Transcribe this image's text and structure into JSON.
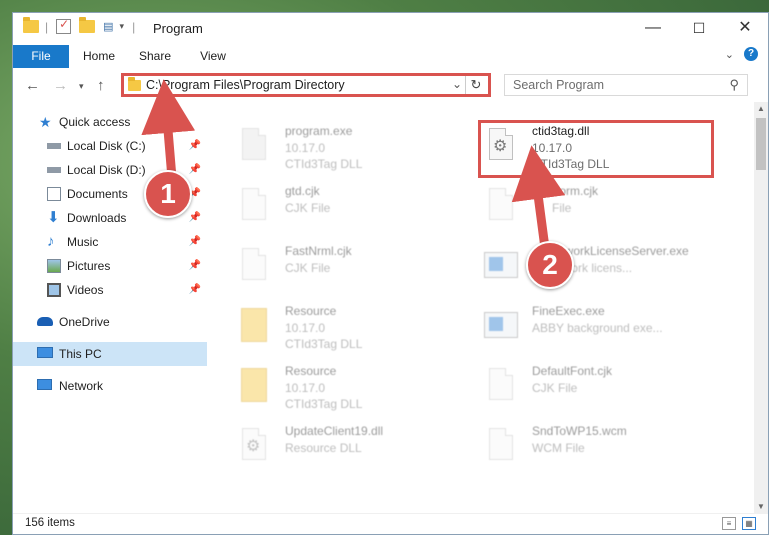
{
  "window": {
    "title": "Program",
    "controls": {
      "minimize": "—",
      "maximize": "☐",
      "close": "✕"
    }
  },
  "ribbon": {
    "tabs": [
      "File",
      "Home",
      "Share",
      "View"
    ],
    "expand_icon": "chevron-down-icon",
    "help": "?"
  },
  "address": {
    "path": "C:\\Program Files\\Program Directory",
    "search_placeholder": "Search Program"
  },
  "sidebar": {
    "items": [
      {
        "label": "Quick access",
        "icon": "star-icon",
        "pinned": false
      },
      {
        "label": "Local Disk (C:)",
        "icon": "drive-icon",
        "pinned": true
      },
      {
        "label": "Local Disk (D:)",
        "icon": "drive-icon",
        "pinned": true
      },
      {
        "label": "Documents",
        "icon": "documents-icon",
        "pinned": true
      },
      {
        "label": "Downloads",
        "icon": "download-icon",
        "pinned": true
      },
      {
        "label": "Music",
        "icon": "music-icon",
        "pinned": true
      },
      {
        "label": "Pictures",
        "icon": "pictures-icon",
        "pinned": true
      },
      {
        "label": "Videos",
        "icon": "videos-icon",
        "pinned": true
      },
      {
        "label": "OneDrive",
        "icon": "cloud-icon",
        "pinned": false
      },
      {
        "label": "This PC",
        "icon": "computer-icon",
        "pinned": false,
        "selected": true
      },
      {
        "label": "Network",
        "icon": "network-icon",
        "pinned": false
      }
    ]
  },
  "files": [
    {
      "name": "program.exe",
      "meta1": "10.17.0",
      "meta2": "CTId3Tag DLL",
      "icon": "exe-icon",
      "faded": true
    },
    {
      "name": "ctid3tag.dll",
      "meta1": "10.17.0",
      "meta2": "CTId3Tag DLL",
      "icon": "dll-gear-icon",
      "faded": false,
      "highlighted": true
    },
    {
      "name": "gtd.cjk",
      "meta1": "CJK File",
      "meta2": "",
      "icon": "file-icon",
      "faded": true
    },
    {
      "name": "Form.cjk",
      "meta1": "File",
      "meta2": "",
      "icon": "file-icon",
      "faded": true
    },
    {
      "name": "FastNrml.cjk",
      "meta1": "CJK File",
      "meta2": "",
      "icon": "file-icon",
      "faded": true
    },
    {
      "name": "NetworkLicenseServer.exe",
      "meta1": "network licens...",
      "meta2": "",
      "icon": "app-icon",
      "faded": true
    },
    {
      "name": "Resource",
      "meta1": "10.17.0",
      "meta2": "CTId3Tag DLL",
      "icon": "folder-file-icon",
      "faded": true
    },
    {
      "name": "FineExec.exe",
      "meta1": "ABBY background exe...",
      "meta2": "",
      "icon": "app-icon",
      "faded": true
    },
    {
      "name": "Resource",
      "meta1": "10.17.0",
      "meta2": "CTId3Tag DLL",
      "icon": "folder-file-icon",
      "faded": true
    },
    {
      "name": "DefaultFont.cjk",
      "meta1": "CJK File",
      "meta2": "",
      "icon": "file-icon",
      "faded": true
    },
    {
      "name": "UpdateClient19.dll",
      "meta1": "Resource DLL",
      "meta2": "",
      "icon": "dll-gear-icon",
      "faded": true
    },
    {
      "name": "SndToWP15.wcm",
      "meta1": "WCM File",
      "meta2": "",
      "icon": "file-icon",
      "faded": true
    }
  ],
  "status": {
    "item_count": "156 items"
  },
  "annotations": {
    "step1": "1",
    "step2": "2"
  },
  "colors": {
    "accent": "#1979ca",
    "highlight": "#d9534f",
    "selected": "#cce4f7"
  }
}
